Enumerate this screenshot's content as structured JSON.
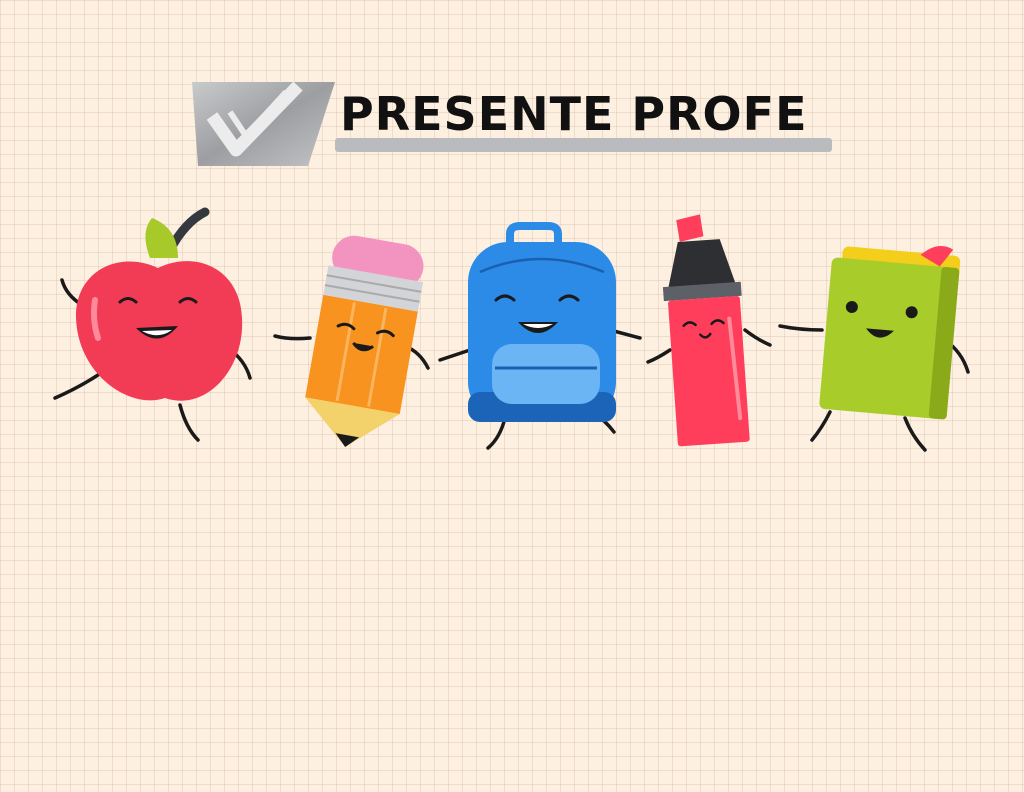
{
  "brand": {
    "title": "PRESENTE PROFE",
    "logo_icon": "checkmark-icon"
  },
  "characters": [
    {
      "name": "apple",
      "icon": "apple-icon",
      "color": "#f23b55"
    },
    {
      "name": "pencil",
      "icon": "pencil-icon",
      "color": "#f7931e"
    },
    {
      "name": "backpack",
      "icon": "backpack-icon",
      "color": "#2b8be6"
    },
    {
      "name": "highlighter",
      "icon": "highlighter-icon",
      "color": "#ff3e5c"
    },
    {
      "name": "book",
      "icon": "book-icon",
      "color": "#a8cc2a"
    }
  ],
  "colors": {
    "background": "#fdf0e0",
    "title_text": "#111111",
    "logo_grey": "#a9abae"
  }
}
